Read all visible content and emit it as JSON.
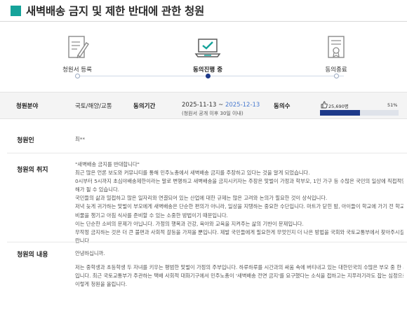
{
  "header": {
    "title": "새벽배송 금지 및 제한 반대에 관한 청원"
  },
  "steps": [
    {
      "label": "청원서 등록",
      "active": false
    },
    {
      "label": "동의진행 중",
      "active": true
    },
    {
      "label": "동의종료",
      "active": false
    }
  ],
  "info": {
    "field_label": "청원분야",
    "field_value": "국토/해양/교통",
    "period_label": "동의기간",
    "period_start": "2025-11-13",
    "period_sep": " ~ ",
    "period_end": "2025-12-13",
    "period_note": "(청원서 공개 이후 30일 이내)",
    "agree_label": "동의수",
    "agree_count": "25,690명",
    "agree_percent": "51%",
    "agree_ratio": 0.51
  },
  "petitioner": {
    "label": "청원인",
    "value": "최**"
  },
  "purpose": {
    "label": "청원의 취지",
    "lines": [
      "\"새벽배송 금지를 반대합니다\"",
      "  최근 많은 언론 보도와 커뮤니티를 통해 민주노총에서 새벽배송 금지를 주장하고 있다는 것을 알게 되었습니다.",
      "  0시부터 5시까지 초심야배송제한이라는 말로 변명하고 새벽배송을 금지시키자는 주장은 맞벌이 가정과 학부모, 1인 가구 등 수많은 국민의 일상에 직접적인 피",
      "  해가 될 수 있습니다.",
      "  국민들의 삶과 밀접하고 많은 일자리와 연결되어 있는 산업에 대한 규제는 많은 고려와 논의가 필요한 것이 상식입니다.",
      "  저녁 늦게 귀가하는 맞벌이 부모에게 새벽배송은 단순한 편의가 아니라, 일상을 지탱하는 중요한 수단입니다. 마트가 닫힌 밤, 아이들이 학교에 가기 전 학교 준",
      "  비물을 챙기고 아침 식사를 준비할 수 있는 소중한 방법이기 때문입니다.",
      "  이는 단순한 소비의 문제가 아닙니다. 가정의 행복과 건강, 육아와 교육을 지켜주는 삶의 기반이 문제입니다.",
      "  무작정 금지하는 것은 더 큰 불편과 사회적 갈등을 가져올 뿐입니다. 제발 국민들에게 필요한게 무엇인지 더 나은 방법을 국회와 국토교통부에서 찾아주시길 바",
      "  랍니다."
    ]
  },
  "content": {
    "label": "청원의 내용",
    "greeting": "안녕하십니까.",
    "lines": [
      "저는 중학생과 초등학생 두 자녀를 키우는 평범한 맞벌이 가정의 주부입니다. 하루하루를 시간과의 싸움 속에 버티내고 있는 대한민국의 수많은 부모 중 한 사람",
      "입니다. 최근 국토교통부가 주관하는 택배 사회적 대화기구에서 민주노총이 '새벽배송 전면 금지'를 요구했다는 소식을 접하고는 지푸라기라도 잡는 심정으로",
      "이렇게 청원을 올립니다."
    ]
  },
  "colors": {
    "accent": "#1e3a8a",
    "teal": "#15a39a",
    "date_end": "#4a7bd0"
  }
}
